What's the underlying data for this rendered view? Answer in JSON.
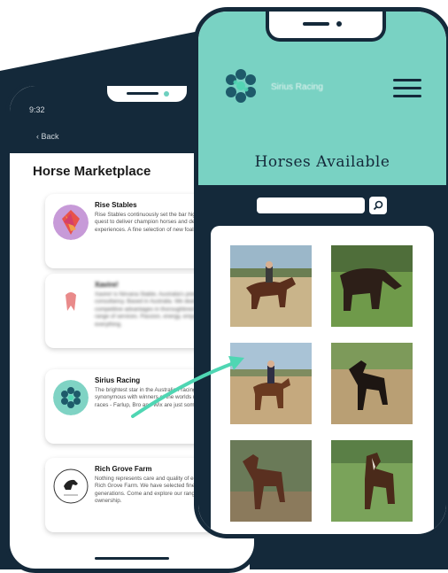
{
  "colors": {
    "navy": "#14293a",
    "teal": "#79d2c3",
    "accent": "#4fd6b3"
  },
  "back_phone": {
    "time": "9:32",
    "back_label": "Back",
    "title": "Horse Marketplace",
    "listings": [
      {
        "name": "Rise Stables",
        "description": "Rise Stables continuously set the bar higher and higher in our quest to deliver champion horses and deliver winning experiences. A fine selection of new foals available now."
      },
      {
        "name": "Xavire!",
        "description": "Xavire! is Nirvana Stable, Australia's premier bloodstock consultancy. Based in Australia. We deal with long term competitive advantages in thoroughbred breeding through our range of services. Passion, energy, empathy and integrity are everything."
      },
      {
        "name": "Sirius Racing",
        "description": "The brightest star in the Australian racing sky, Sirius Racing is synonymous with winners of the worlds most prestigious horse races - Farlup, Bro and Wix are just some of our finest."
      },
      {
        "name": "Rich Grove Farm",
        "description": "Nothing represents care and quality of equine training more than Rich Grove Farm. We have selected fine bloodlines for generations. Come and explore our range of horses available for ownership."
      }
    ]
  },
  "front_phone": {
    "brand": "Sirius Racing",
    "heading": "Horses Available",
    "search": {
      "placeholder": "",
      "value": ""
    },
    "icons": {
      "search": "search-icon",
      "menu": "hamburger-menu-icon"
    }
  }
}
